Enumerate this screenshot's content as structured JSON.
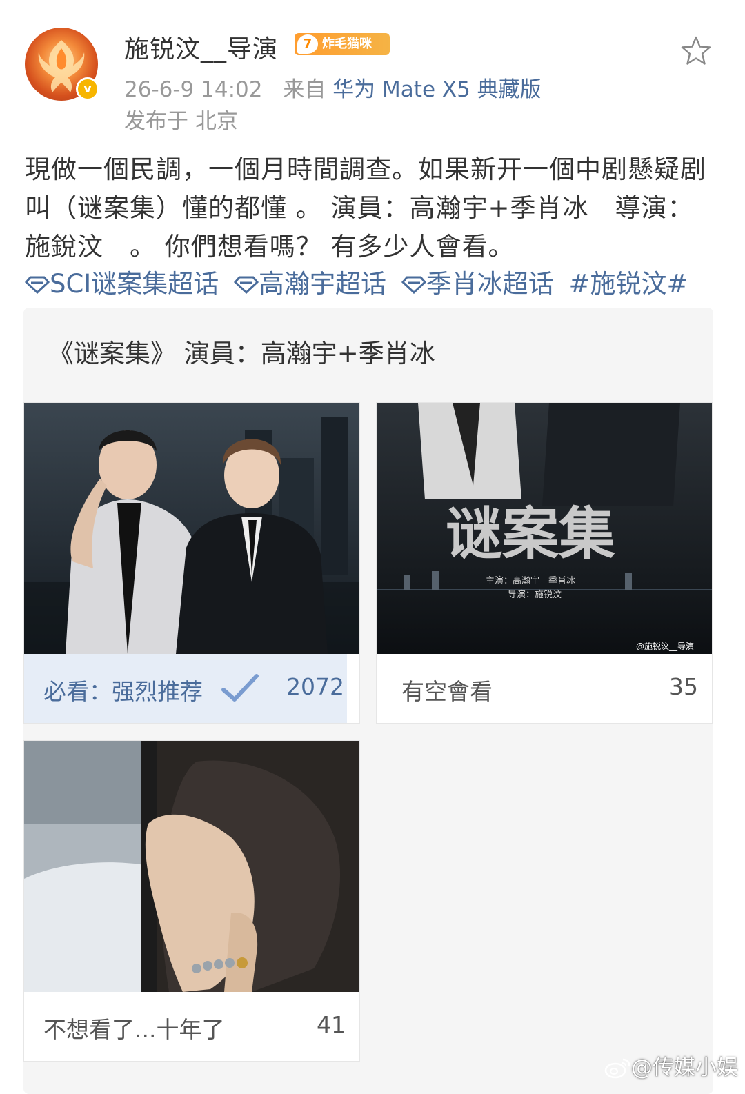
{
  "user": {
    "name": "施锐汶__导演",
    "level": "7",
    "badge_text": "炸毛猫咪",
    "verified_mark": "v"
  },
  "meta": {
    "time": "26-6-9 14:02",
    "source_prefix": "来自",
    "device": "华为 Mate X5 典藏版",
    "location": "发布于 北京"
  },
  "post": {
    "text": "現做一個民調，一個月時間調查。如果新开一個中剧懸疑剧 叫（谜案集）懂的都懂 。 演員：高瀚宇+季肖冰　導演：施銳汶　。 你們想看嗎？ 有多少人會看。",
    "tags": [
      "SCI谜案集超话",
      "高瀚宇超话",
      "季肖冰超话"
    ],
    "hashtag": "#施锐汶#"
  },
  "vote": {
    "title": "《谜案集》 演員：高瀚宇+季肖冰",
    "options": [
      {
        "label": "必看：强烈推荐",
        "count": "2072",
        "selected": true
      },
      {
        "label": "有空會看",
        "count": "35",
        "selected": false
      },
      {
        "label": "不想看了...十年了",
        "count": "41",
        "selected": false
      }
    ],
    "poster": {
      "title": "谜案集",
      "credits_1": "主演：高瀚宇　季肖冰",
      "credits_2": "导演：施锐汶",
      "credit_mark": "@施锐汶__导演"
    }
  },
  "watermark": "@传媒小娱",
  "colors": {
    "link": "#4a6c9b",
    "selected_bg": "#e6edf7",
    "badge": "#ff9d2f"
  }
}
